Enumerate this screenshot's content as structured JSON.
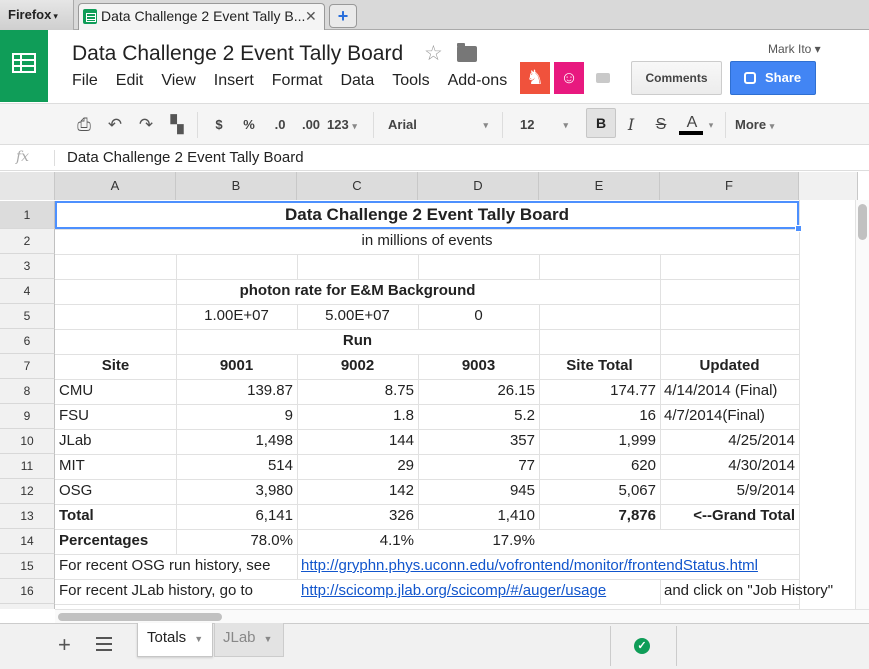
{
  "browser": {
    "menu_label": "Firefox",
    "tab_title": "Data Challenge 2 Event Tally B...",
    "new_tab_symbol": "+"
  },
  "doc": {
    "title": "Data Challenge 2 Event Tally Board",
    "user": "Mark Ito ▾",
    "comments_label": "Comments",
    "share_label": "Share"
  },
  "menu": [
    "File",
    "Edit",
    "View",
    "Insert",
    "Format",
    "Data",
    "Tools",
    "Add-ons"
  ],
  "toolbar": {
    "currency": "$",
    "percent": "%",
    "dec_decrease": ".0",
    "dec_increase": ".00",
    "number_format": "123",
    "font": "Arial",
    "font_size": "12",
    "bold": "B",
    "italic": "I",
    "strike": "S",
    "text_color": "A",
    "more": "More"
  },
  "formula_bar": {
    "fx": "fx",
    "content": "Data Challenge 2 Event Tally Board"
  },
  "grid": {
    "columns": [
      "A",
      "B",
      "C",
      "D",
      "E",
      "F"
    ],
    "rows": [
      "1",
      "2",
      "3",
      "4",
      "5",
      "6",
      "7",
      "8",
      "9",
      "10",
      "11",
      "12",
      "13",
      "14",
      "15",
      "16"
    ],
    "title": "Data Challenge 2 Event Tally Board",
    "subtitle": "in millions of events",
    "photon_label": "photon rate for E&M Background",
    "photon_rates": [
      "1.00E+07",
      "5.00E+07",
      "0"
    ],
    "run_label": "Run",
    "header": [
      "Site",
      "9001",
      "9002",
      "9003",
      "Site Total",
      "Updated"
    ],
    "sites": [
      [
        "CMU",
        "139.87",
        "8.75",
        "26.15",
        "174.77",
        "4/14/2014 (Final)"
      ],
      [
        "FSU",
        "9",
        "1.8",
        "5.2",
        "16",
        "4/7/2014(Final)"
      ],
      [
        "JLab",
        "1,498",
        "144",
        "357",
        "1,999",
        "4/25/2014"
      ],
      [
        "MIT",
        "514",
        "29",
        "77",
        "620",
        "4/30/2014"
      ],
      [
        "OSG",
        "3,980",
        "142",
        "945",
        "5,067",
        "5/9/2014"
      ]
    ],
    "total": [
      "Total",
      "6,141",
      "326",
      "1,410",
      "7,876",
      "<--Grand Total"
    ],
    "percentages": [
      "Percentages",
      "78.0%",
      "4.1%",
      "17.9%"
    ],
    "osg_note": "For recent OSG run history, see",
    "osg_link": "http://gryphn.phys.uconn.edu/vofrontend/monitor/frontendStatus.html",
    "jlab_note": "For recent JLab history, go to",
    "jlab_link": "http://scicomp.jlab.org/scicomp/#/auger/usage",
    "jlab_tail": "and click on \"Job History\""
  },
  "sheets": [
    "Totals",
    "JLab"
  ],
  "colors": {
    "sheets_green": "#0f9d58",
    "share_blue": "#4285f4",
    "selection_blue": "#4d90fe",
    "link_blue": "#1155cc"
  }
}
